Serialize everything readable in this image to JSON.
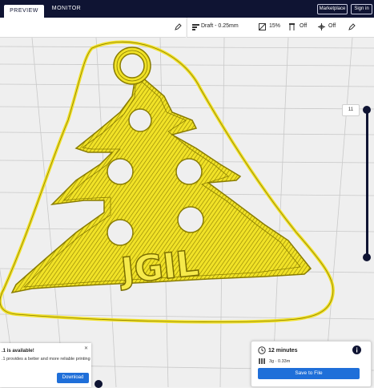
{
  "header": {
    "tabs": [
      {
        "label": "PREVIEW",
        "active": true
      },
      {
        "label": "MONITOR",
        "active": false
      }
    ],
    "marketplace_label": "Marketplace",
    "signin_label": "Sign in"
  },
  "print_settings": {
    "profile": "Draft - 0.25mm",
    "infill": "15%",
    "support": "Off",
    "adhesion": "Off"
  },
  "layer_slider": {
    "current_layer": "11"
  },
  "update_toast": {
    "title": ".1 is available!",
    "body": ".1 provides a better and more reliable printing",
    "button_label": "Download"
  },
  "print_panel": {
    "time": "12 minutes",
    "material": "3g · 0.33m",
    "save_label": "Save to File"
  },
  "colors": {
    "header_bg": "#0f1433",
    "accent_blue": "#1f6fd9",
    "model_yellow": "#f2e22a",
    "slider_blue": "#0f1433"
  },
  "model_text": "JGIL"
}
